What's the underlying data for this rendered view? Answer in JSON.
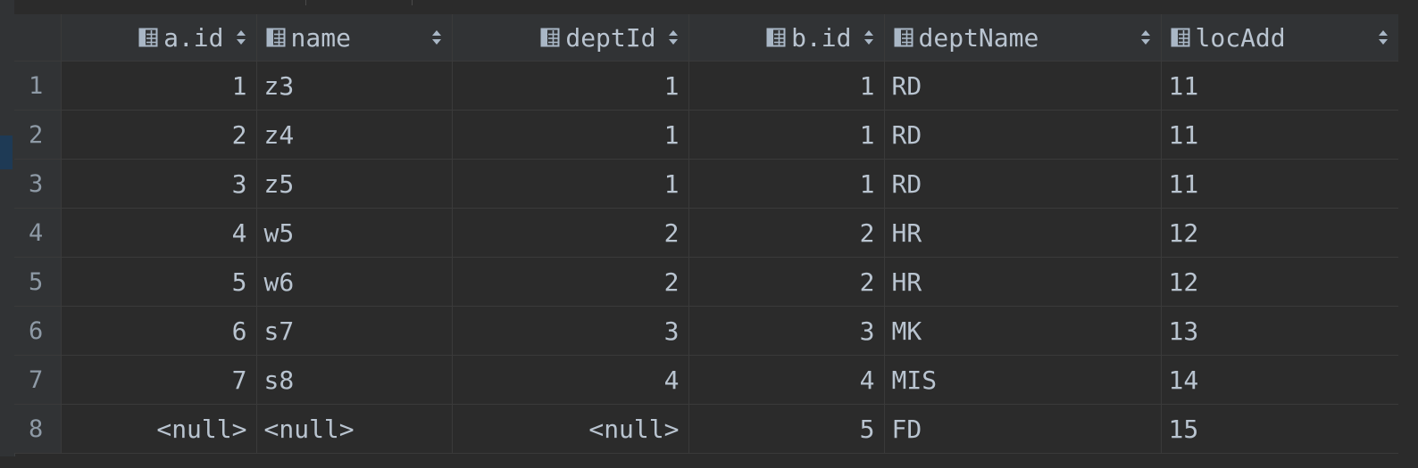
{
  "columns": [
    {
      "name": "a.id",
      "align": "right"
    },
    {
      "name": "name",
      "align": "left"
    },
    {
      "name": "deptId",
      "align": "right"
    },
    {
      "name": "b.id",
      "align": "right"
    },
    {
      "name": "deptName",
      "align": "left"
    },
    {
      "name": "locAdd",
      "align": "left"
    }
  ],
  "rows": [
    {
      "num": "1",
      "cells": [
        "1",
        "z3",
        "1",
        "1",
        "RD",
        "11"
      ]
    },
    {
      "num": "2",
      "cells": [
        "2",
        "z4",
        "1",
        "1",
        "RD",
        "11"
      ]
    },
    {
      "num": "3",
      "cells": [
        "3",
        "z5",
        "1",
        "1",
        "RD",
        "11"
      ]
    },
    {
      "num": "4",
      "cells": [
        "4",
        "w5",
        "2",
        "2",
        "HR",
        "12"
      ]
    },
    {
      "num": "5",
      "cells": [
        "5",
        "w6",
        "2",
        "2",
        "HR",
        "12"
      ]
    },
    {
      "num": "6",
      "cells": [
        "6",
        "s7",
        "3",
        "3",
        "MK",
        "13"
      ]
    },
    {
      "num": "7",
      "cells": [
        "7",
        "s8",
        "4",
        "4",
        "MIS",
        "14"
      ]
    },
    {
      "num": "8",
      "cells": [
        "<null>",
        "<null>",
        "<null>",
        "5",
        "FD",
        "15"
      ]
    }
  ],
  "null_text": "<null>",
  "icons": {
    "column": "column-table-icon",
    "sort": "sort-toggle-icon"
  },
  "colors": {
    "background": "#2b2b2b",
    "header": "#313335",
    "text": "#b9c4d0",
    "null": "#7a7a7a",
    "grid": "#3a3a3a"
  }
}
